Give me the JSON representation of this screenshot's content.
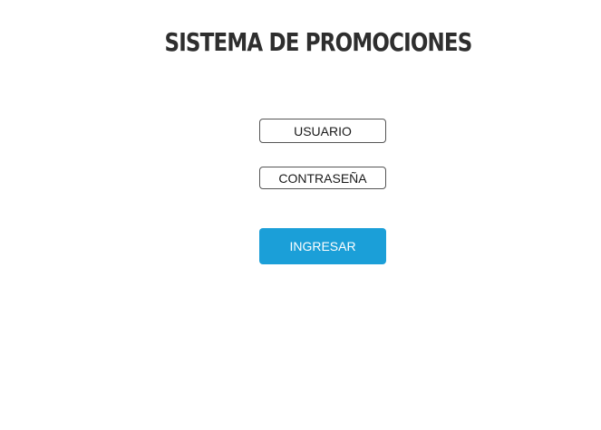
{
  "page": {
    "title": "SISTEMA DE PROMOCIONES"
  },
  "login_form": {
    "username_placeholder": "USUARIO",
    "password_placeholder": "CONTRASEÑA",
    "submit_label": "INGRESAR"
  },
  "colors": {
    "title_text": "#2e2e2e",
    "field_border": "#555555",
    "button_background": "#1b9fd8",
    "button_text": "#ffffff",
    "page_background": "#ffffff"
  }
}
